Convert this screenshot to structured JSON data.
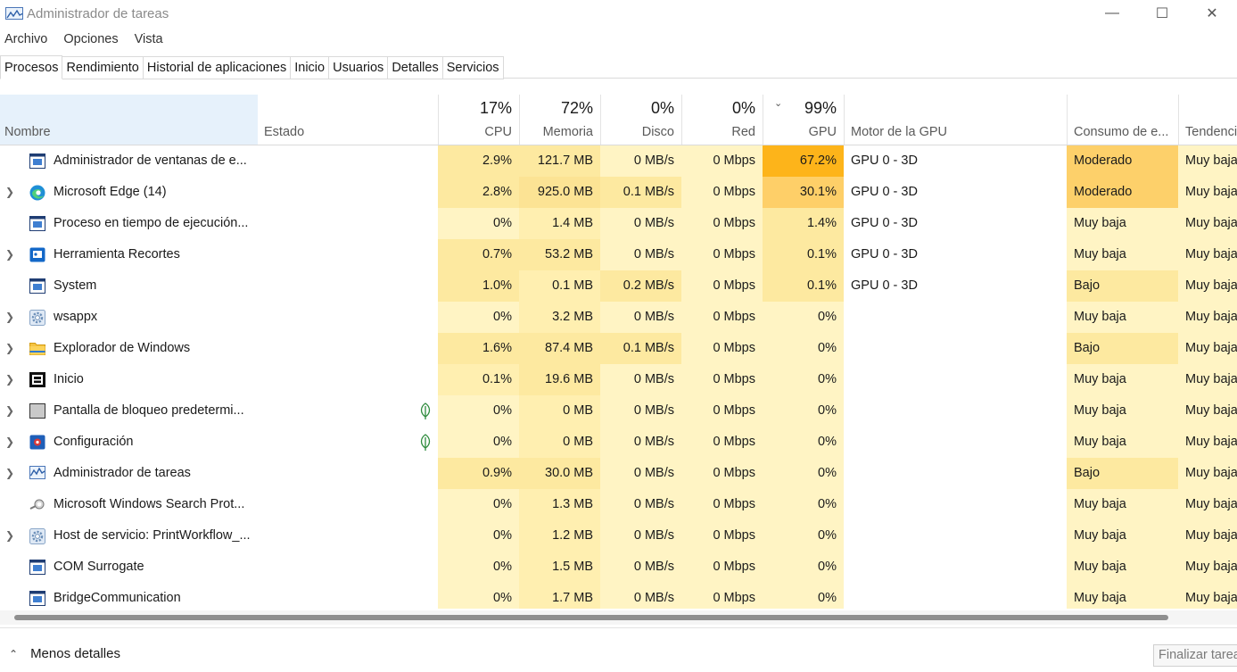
{
  "window": {
    "title": "Administrador de tareas",
    "minimize": "—",
    "maximize": "☐",
    "close": "✕"
  },
  "menu": [
    "Archivo",
    "Opciones",
    "Vista"
  ],
  "tabs": [
    "Procesos",
    "Rendimiento",
    "Historial de aplicaciones",
    "Inicio",
    "Usuarios",
    "Detalles",
    "Servicios"
  ],
  "active_tab": "Procesos",
  "columns": {
    "name": "Nombre",
    "status": "Estado",
    "cpu": {
      "label": "CPU",
      "pct": "17%"
    },
    "memory": {
      "label": "Memoria",
      "pct": "72%"
    },
    "disk": {
      "label": "Disco",
      "pct": "0%"
    },
    "network": {
      "label": "Red",
      "pct": "0%"
    },
    "gpu": {
      "label": "GPU",
      "pct": "99%",
      "sort_indicator": "⌄"
    },
    "gpu_engine": "Motor de la GPU",
    "power": "Consumo de e...",
    "trend": "Tendenci"
  },
  "rows": [
    {
      "expandable": false,
      "icon": "window-icon",
      "name": "Administrador de ventanas de e...",
      "eco": false,
      "cpu": "2.9%",
      "memory": "121.7 MB",
      "disk": "0 MB/s",
      "network": "0 Mbps",
      "gpu": "67.2%",
      "gpu_engine": "GPU 0 - 3D",
      "power": "Moderado",
      "trend": "Muy baja"
    },
    {
      "expandable": true,
      "icon": "edge-icon",
      "name": "Microsoft Edge (14)",
      "eco": false,
      "cpu": "2.8%",
      "memory": "925.0 MB",
      "disk": "0.1 MB/s",
      "network": "0 Mbps",
      "gpu": "30.1%",
      "gpu_engine": "GPU 0 - 3D",
      "power": "Moderado",
      "trend": "Muy baja"
    },
    {
      "expandable": false,
      "icon": "window-icon",
      "name": "Proceso en tiempo de ejecución...",
      "eco": false,
      "cpu": "0%",
      "memory": "1.4 MB",
      "disk": "0 MB/s",
      "network": "0 Mbps",
      "gpu": "1.4%",
      "gpu_engine": "GPU 0 - 3D",
      "power": "Muy baja",
      "trend": "Muy baja"
    },
    {
      "expandable": true,
      "icon": "snipping-tool-icon",
      "name": "Herramienta Recortes",
      "eco": false,
      "cpu": "0.7%",
      "memory": "53.2 MB",
      "disk": "0 MB/s",
      "network": "0 Mbps",
      "gpu": "0.1%",
      "gpu_engine": "GPU 0 - 3D",
      "power": "Muy baja",
      "trend": "Muy baja"
    },
    {
      "expandable": false,
      "icon": "window-icon",
      "name": "System",
      "eco": false,
      "cpu": "1.0%",
      "memory": "0.1 MB",
      "disk": "0.2 MB/s",
      "network": "0 Mbps",
      "gpu": "0.1%",
      "gpu_engine": "GPU 0 - 3D",
      "power": "Bajo",
      "trend": "Muy baja"
    },
    {
      "expandable": true,
      "icon": "gear-icon",
      "name": "wsappx",
      "eco": false,
      "cpu": "0%",
      "memory": "3.2 MB",
      "disk": "0 MB/s",
      "network": "0 Mbps",
      "gpu": "0%",
      "gpu_engine": "",
      "power": "Muy baja",
      "trend": "Muy baja"
    },
    {
      "expandable": true,
      "icon": "folder-icon",
      "name": "Explorador de Windows",
      "eco": false,
      "cpu": "1.6%",
      "memory": "87.4 MB",
      "disk": "0.1 MB/s",
      "network": "0 Mbps",
      "gpu": "0%",
      "gpu_engine": "",
      "power": "Bajo",
      "trend": "Muy baja"
    },
    {
      "expandable": true,
      "icon": "start-icon",
      "name": "Inicio",
      "eco": false,
      "cpu": "0.1%",
      "memory": "19.6 MB",
      "disk": "0 MB/s",
      "network": "0 Mbps",
      "gpu": "0%",
      "gpu_engine": "",
      "power": "Muy baja",
      "trend": "Muy baja"
    },
    {
      "expandable": true,
      "icon": "lock-screen-icon",
      "name": "Pantalla de bloqueo predetermi...",
      "eco": true,
      "cpu": "0%",
      "memory": "0 MB",
      "disk": "0 MB/s",
      "network": "0 Mbps",
      "gpu": "0%",
      "gpu_engine": "",
      "power": "Muy baja",
      "trend": "Muy baja"
    },
    {
      "expandable": true,
      "icon": "settings-icon",
      "name": "Configuración",
      "eco": true,
      "cpu": "0%",
      "memory": "0 MB",
      "disk": "0 MB/s",
      "network": "0 Mbps",
      "gpu": "0%",
      "gpu_engine": "",
      "power": "Muy baja",
      "trend": "Muy baja"
    },
    {
      "expandable": true,
      "icon": "task-manager-icon",
      "name": "Administrador de tareas",
      "eco": false,
      "cpu": "0.9%",
      "memory": "30.0 MB",
      "disk": "0 MB/s",
      "network": "0 Mbps",
      "gpu": "0%",
      "gpu_engine": "",
      "power": "Bajo",
      "trend": "Muy baja"
    },
    {
      "expandable": false,
      "icon": "search-protocol-icon",
      "name": "Microsoft Windows Search Prot...",
      "eco": false,
      "cpu": "0%",
      "memory": "1.3 MB",
      "disk": "0 MB/s",
      "network": "0 Mbps",
      "gpu": "0%",
      "gpu_engine": "",
      "power": "Muy baja",
      "trend": "Muy baja"
    },
    {
      "expandable": true,
      "icon": "gear-icon",
      "name": "Host de servicio: PrintWorkflow_...",
      "eco": false,
      "cpu": "0%",
      "memory": "1.2 MB",
      "disk": "0 MB/s",
      "network": "0 Mbps",
      "gpu": "0%",
      "gpu_engine": "",
      "power": "Muy baja",
      "trend": "Muy baja"
    },
    {
      "expandable": false,
      "icon": "window-icon",
      "name": "COM Surrogate",
      "eco": false,
      "cpu": "0%",
      "memory": "1.5 MB",
      "disk": "0 MB/s",
      "network": "0 Mbps",
      "gpu": "0%",
      "gpu_engine": "",
      "power": "Muy baja",
      "trend": "Muy baja"
    },
    {
      "expandable": false,
      "icon": "window-icon",
      "name": "BridgeCommunication",
      "eco": false,
      "cpu": "0%",
      "memory": "1.7 MB",
      "disk": "0 MB/s",
      "network": "0 Mbps",
      "gpu": "0%",
      "gpu_engine": "",
      "power": "Muy baja",
      "trend": "Muy baja"
    }
  ],
  "footer": {
    "less_details": "Menos detalles",
    "end_task": "Finalizar tarea"
  }
}
